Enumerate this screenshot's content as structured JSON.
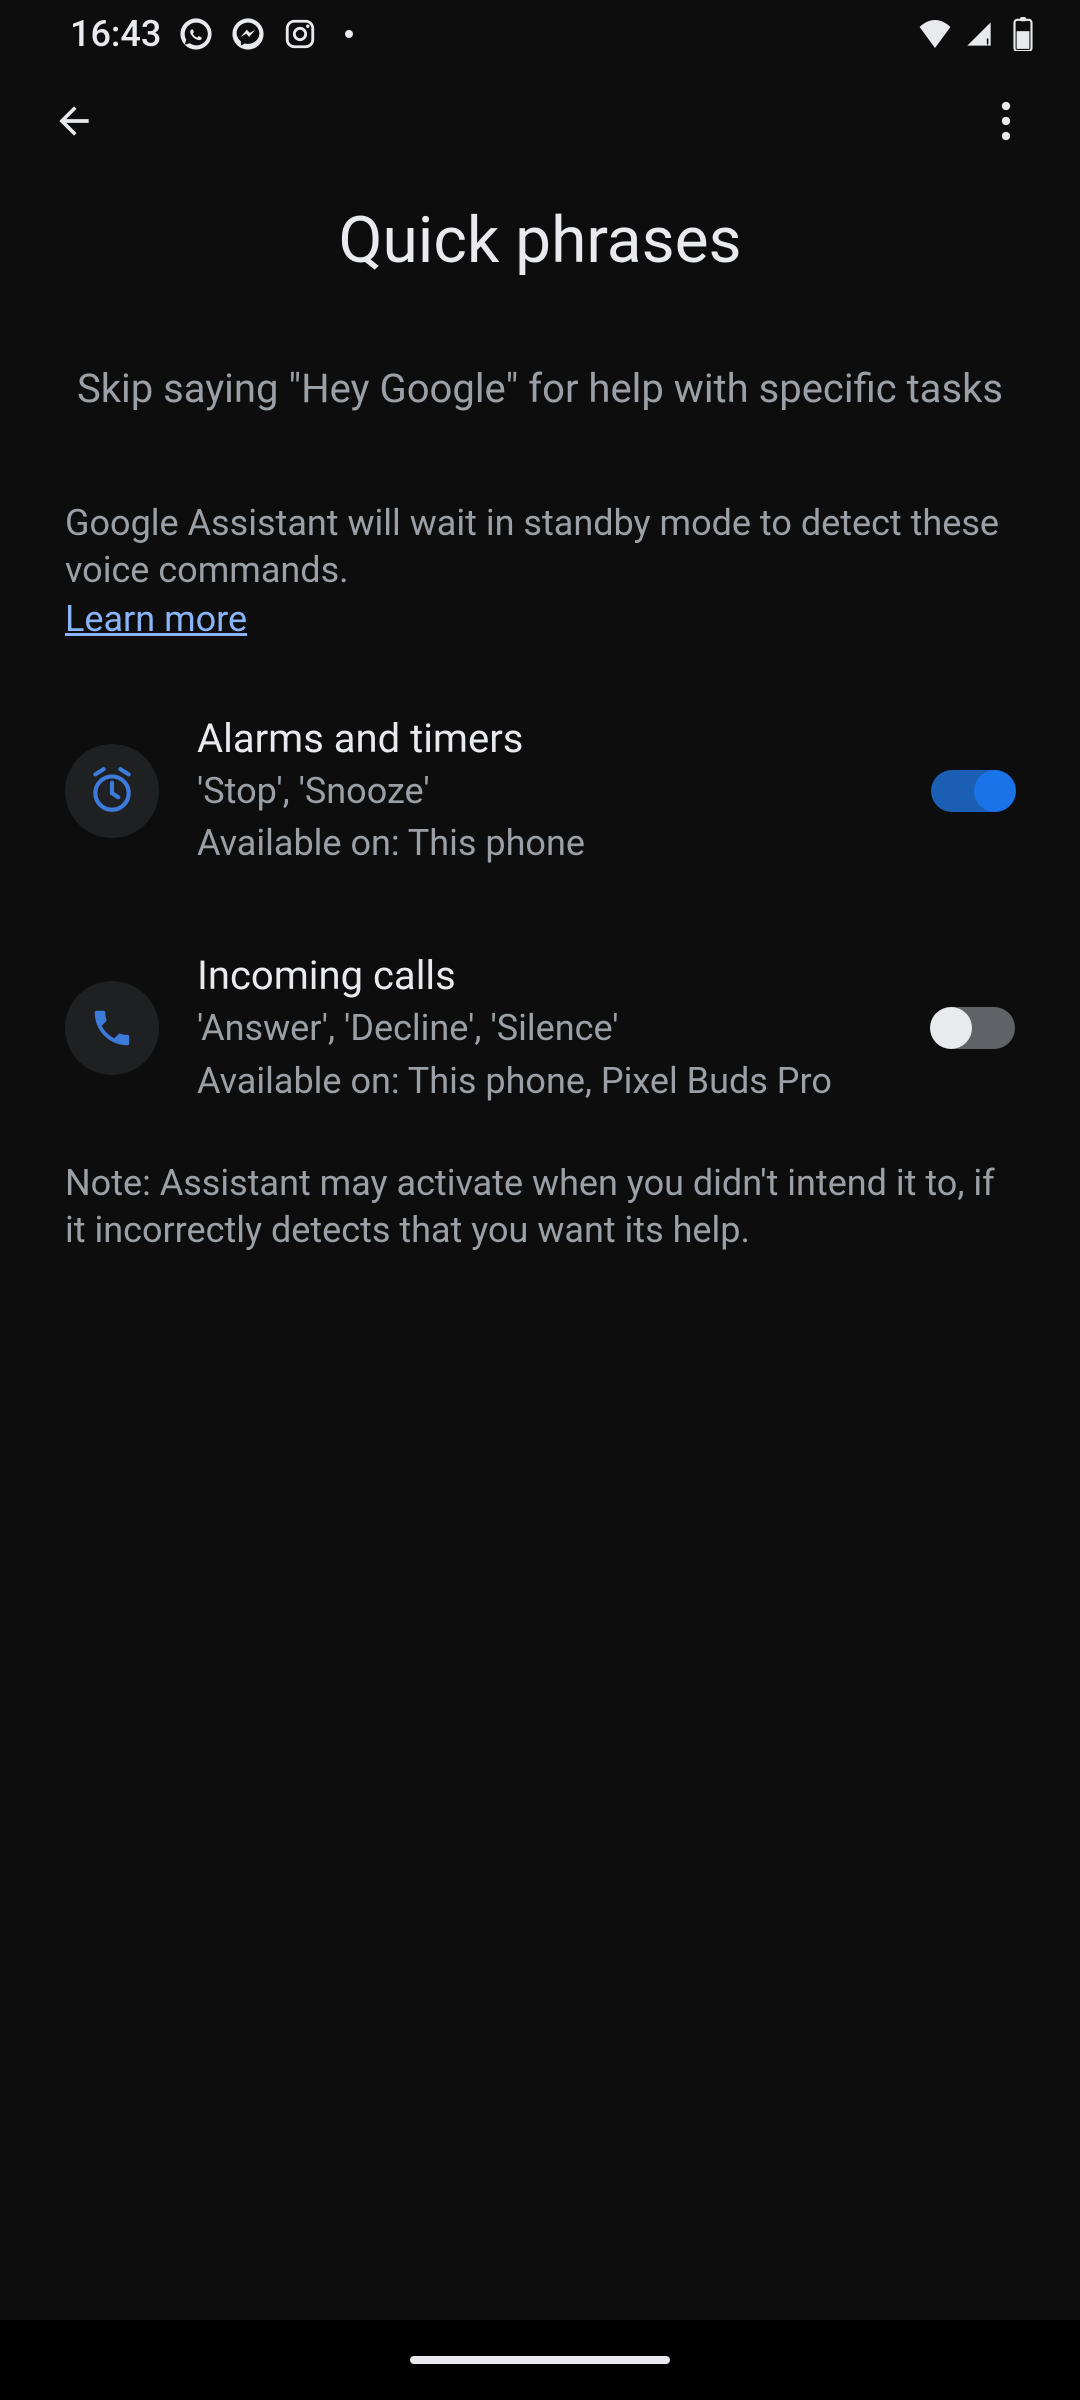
{
  "status": {
    "time": "16:43"
  },
  "toolbar": {},
  "page": {
    "title": "Quick phrases",
    "subtitle": "Skip saying \"Hey Google\" for help with specific tasks",
    "description": "Google Assistant will wait in standby mode to detect these voice commands.",
    "learn_more": "Learn more",
    "note": "Note: Assistant may activate when you didn't intend it to, if it incorrectly detects that you want its help."
  },
  "settings": [
    {
      "title": "Alarms and timers",
      "commands": "'Stop', 'Snooze'",
      "availability": "Available on: This phone",
      "enabled": true,
      "icon": "alarm"
    },
    {
      "title": "Incoming calls",
      "commands": "'Answer', 'Decline', 'Silence'",
      "availability": "Available on: This phone, Pixel Buds Pro",
      "enabled": false,
      "icon": "phone"
    }
  ]
}
